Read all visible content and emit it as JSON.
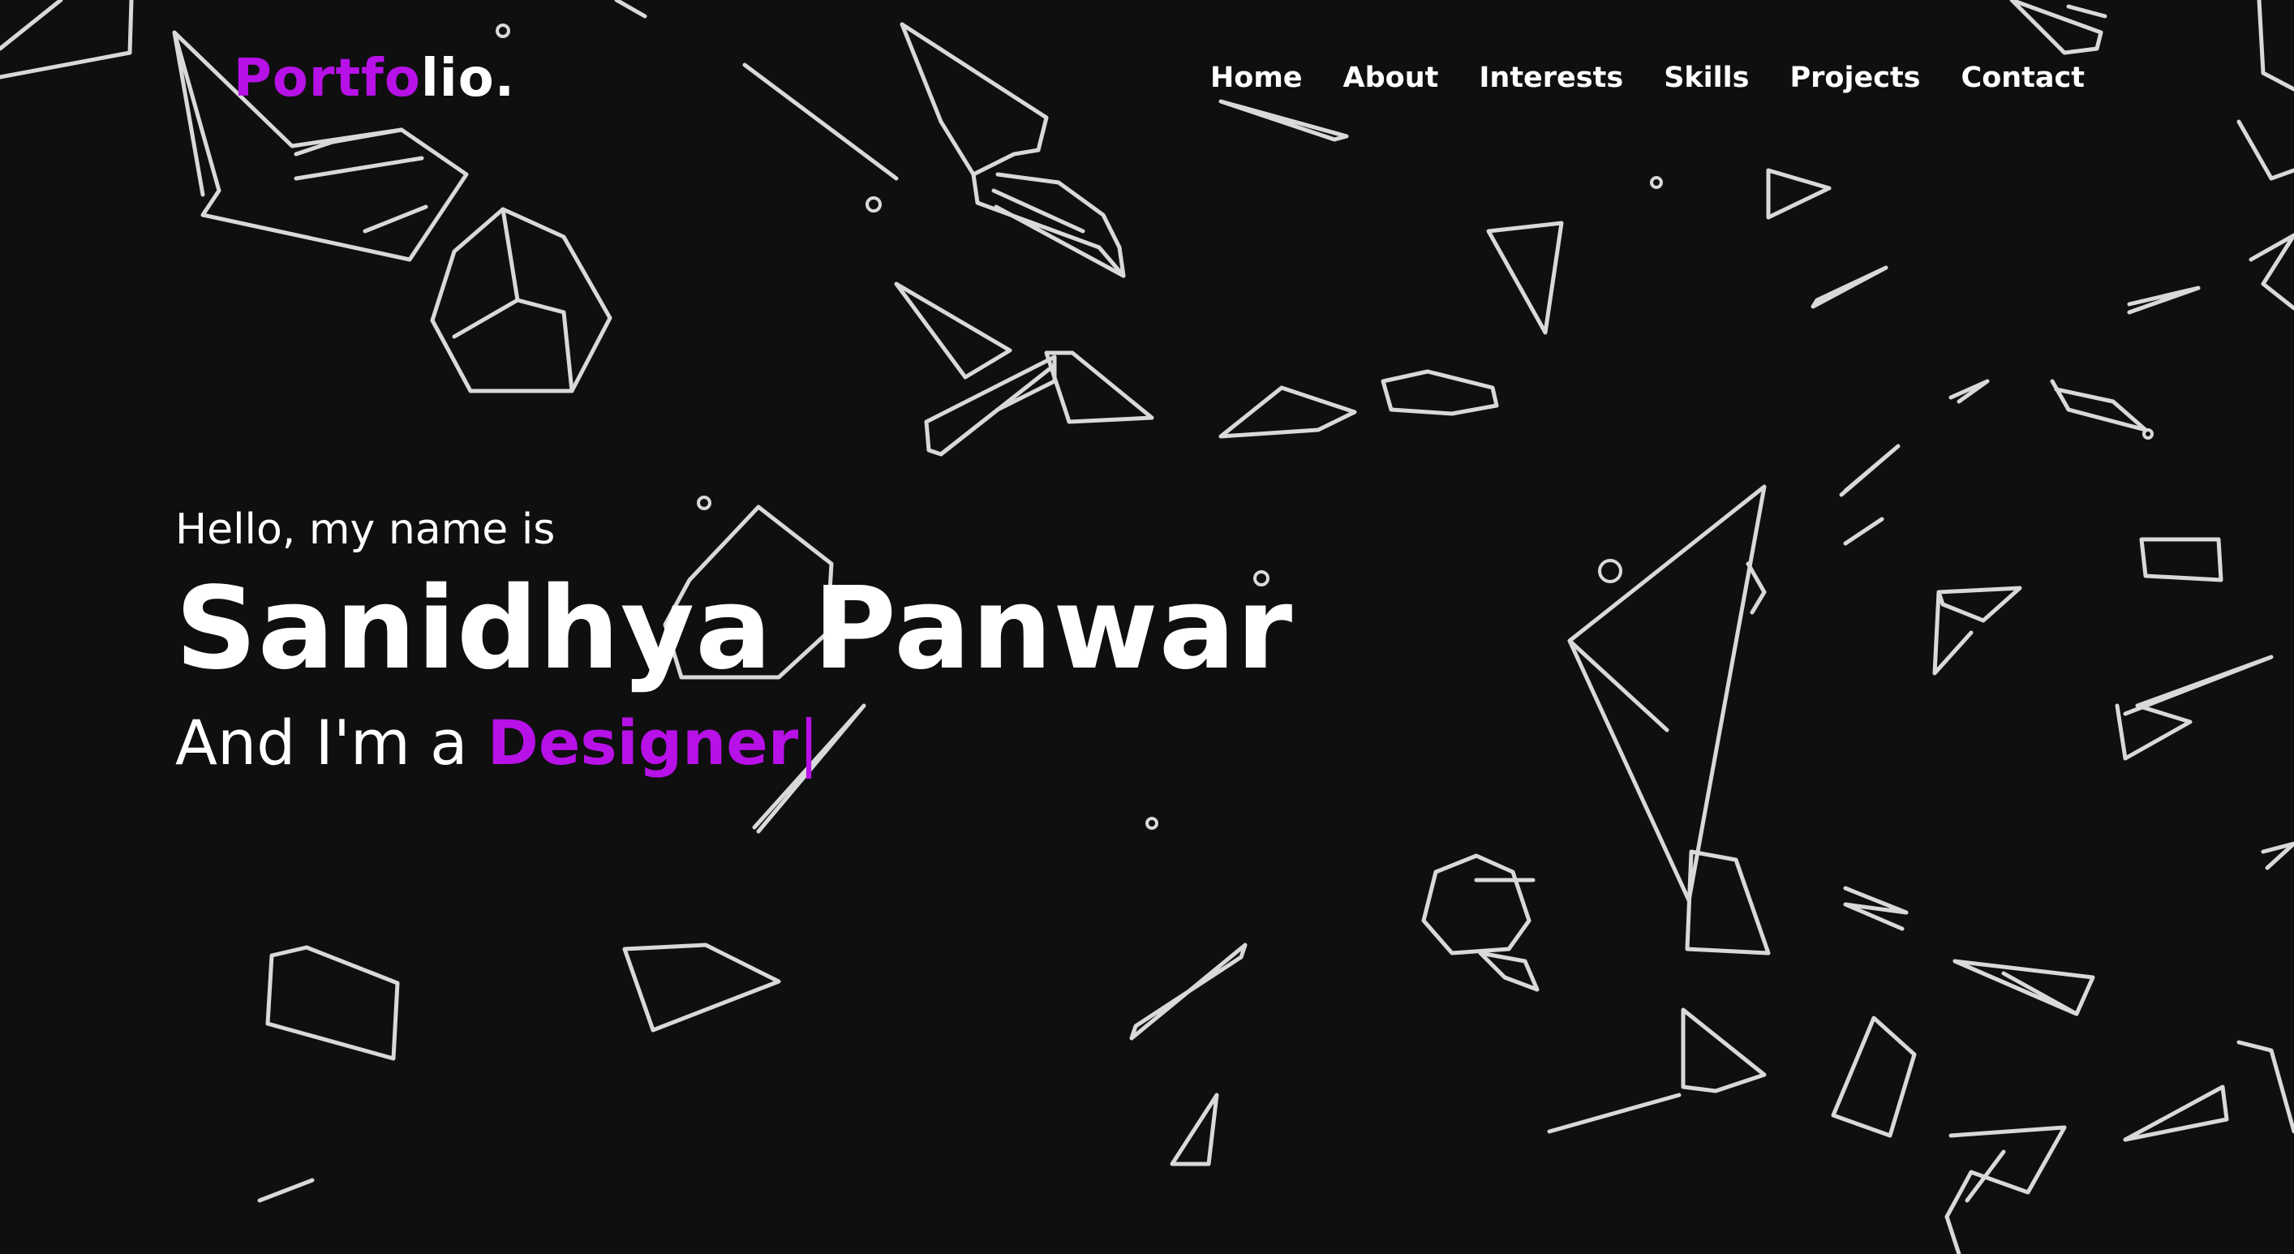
{
  "logo": {
    "accent_part": "Portfo",
    "rest_part": "lio."
  },
  "nav": {
    "items": [
      "Home",
      "About",
      "Interests",
      "Skills",
      "Projects",
      "Contact"
    ]
  },
  "hero": {
    "greeting": "Hello, my name is",
    "name": "Sanidhya Panwar",
    "role_prefix": "And I'm a ",
    "role_typed": "Designer",
    "cursor": "|"
  },
  "colors": {
    "background": "#0f0f0f",
    "accent": "#b711e8",
    "text": "#ffffff",
    "shape_stroke": "#d9d9d9"
  }
}
